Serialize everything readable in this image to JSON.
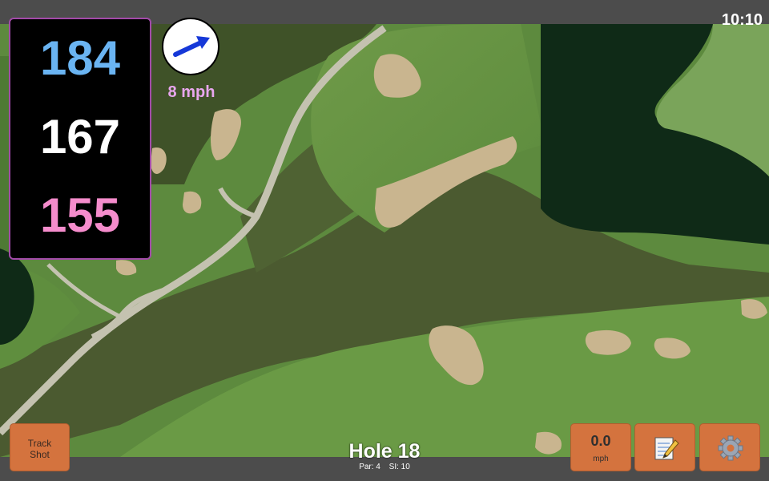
{
  "clock": "10:10",
  "distances": {
    "back": "184",
    "middle": "167",
    "front": "155",
    "back_color": "#6ab4f2",
    "middle_color": "#ffffff",
    "front_color": "#f58ccc"
  },
  "wind": {
    "speed_label": "8 mph",
    "arrow_icon": "wind-direction-arrow",
    "color": "#e8a6ee"
  },
  "controls": {
    "track_shot_line1": "Track",
    "track_shot_line2": "Shot",
    "speed_value": "0.0",
    "speed_unit": "mph",
    "notes_icon": "notepad-pencil",
    "settings_icon": "gear"
  },
  "hole": {
    "title": "Hole 18",
    "par": "Par: 4",
    "si": "SI: 10"
  },
  "colors": {
    "button": "#d4733e",
    "bar": "#4c4c4c",
    "panel_border": "#a24aa8"
  }
}
